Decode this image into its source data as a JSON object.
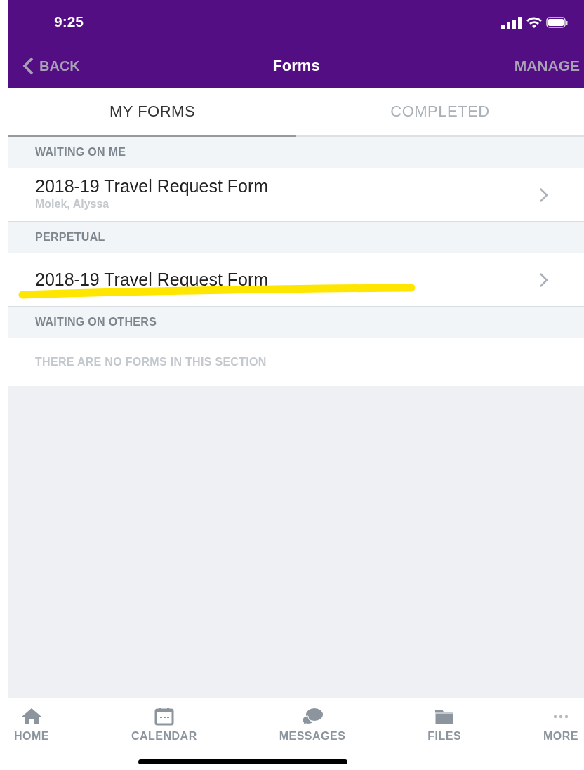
{
  "status_bar": {
    "time": "9:25"
  },
  "nav": {
    "back": "BACK",
    "title": "Forms",
    "action": "MANAGE"
  },
  "tabs": [
    {
      "label": "MY FORMS",
      "selected": true
    },
    {
      "label": "COMPLETED",
      "selected": false
    }
  ],
  "sections": [
    {
      "title": "WAITING ON ME",
      "items": [
        {
          "title": "2018-19 Travel Request Form",
          "subtitle": "Molek, Alyssa",
          "highlighted": false
        }
      ]
    },
    {
      "title": "PERPETUAL",
      "items": [
        {
          "title": "2018-19 Travel Request Form",
          "highlighted": true
        }
      ]
    },
    {
      "title": "WAITING ON OTHERS",
      "empty_text": "THERE ARE NO FORMS IN THIS SECTION"
    }
  ],
  "bottom_tabs": [
    {
      "label": "HOME",
      "kind": "home"
    },
    {
      "label": "CALENDAR",
      "kind": "calendar"
    },
    {
      "label": "MESSAGES",
      "kind": "messages"
    },
    {
      "label": "FILES",
      "kind": "files"
    },
    {
      "label": "MORE",
      "kind": "more"
    }
  ]
}
